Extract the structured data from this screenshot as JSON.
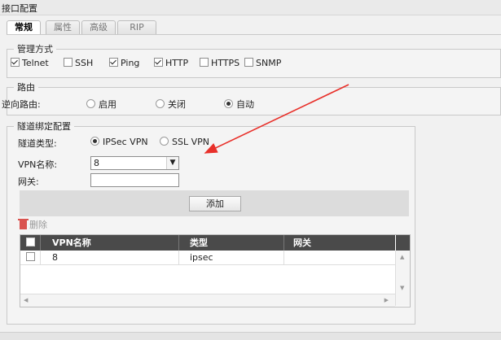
{
  "window": {
    "title": "接口配置"
  },
  "tabs": [
    {
      "label": "常规",
      "active": true
    },
    {
      "label": "属性",
      "active": false
    },
    {
      "label": "高级",
      "active": false
    },
    {
      "label": "RIP",
      "active": false
    }
  ],
  "management": {
    "legend": "管理方式",
    "options": [
      {
        "label": "Telnet",
        "checked": true
      },
      {
        "label": "SSH",
        "checked": false
      },
      {
        "label": "Ping",
        "checked": true
      },
      {
        "label": "HTTP",
        "checked": true
      },
      {
        "label": "HTTPS",
        "checked": false
      },
      {
        "label": "SNMP",
        "checked": false
      }
    ]
  },
  "routing": {
    "legend": "路由",
    "reverse_label": "逆向路由:",
    "options": [
      {
        "label": "启用",
        "selected": false
      },
      {
        "label": "关闭",
        "selected": false
      },
      {
        "label": "自动",
        "selected": true
      }
    ]
  },
  "tunnel": {
    "legend": "隧道绑定配置",
    "type_label": "隧道类型:",
    "types": [
      {
        "label": "IPSec VPN",
        "selected": true
      },
      {
        "label": "SSL VPN",
        "selected": false
      }
    ],
    "vpn_name_label": "VPN名称:",
    "vpn_name_value": "8",
    "gateway_label": "网关:",
    "gateway_value": "",
    "add_button": "添加",
    "delete_label": "删除",
    "table": {
      "headers": [
        "VPN名称",
        "类型",
        "网关"
      ],
      "rows": [
        {
          "vpn": "8",
          "type": "ipsec",
          "gateway": ""
        }
      ]
    }
  },
  "colors": {
    "annotation_arrow": "#e8302a",
    "grid_header": "#4a4a4a"
  }
}
